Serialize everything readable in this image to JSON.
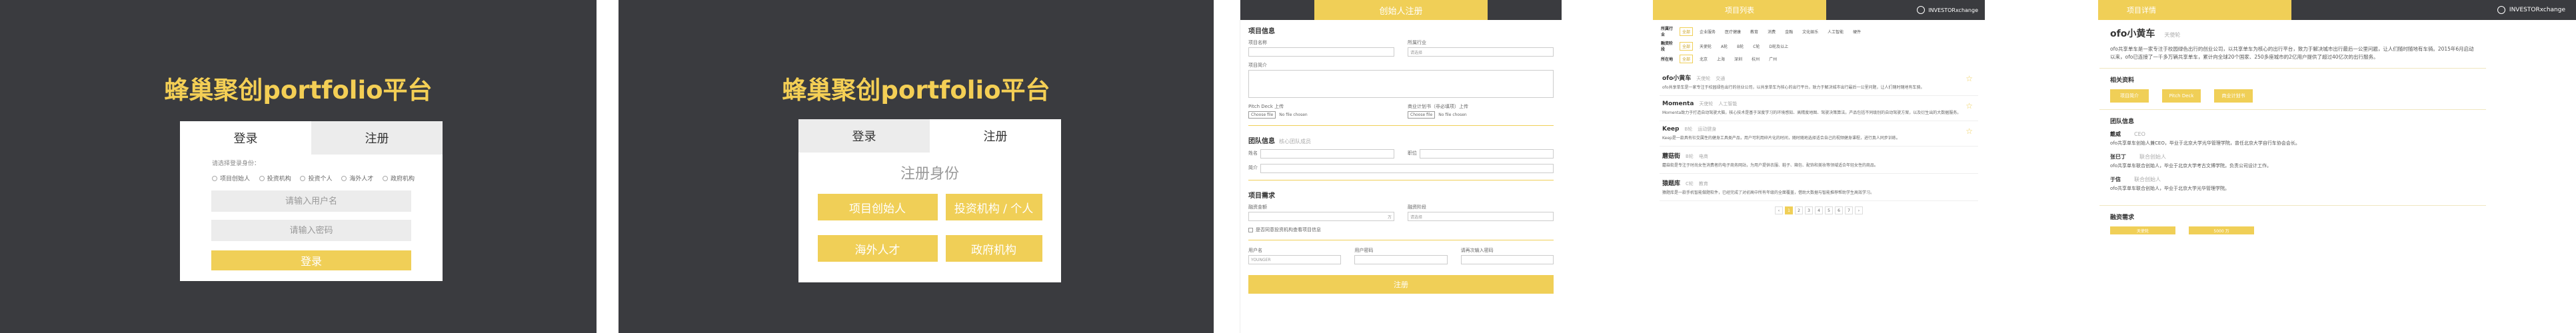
{
  "app_title": "蜂巢聚创portfolio平台",
  "login": {
    "tab_login": "登录",
    "tab_register": "注册",
    "role_prompt": "请选择登录身份：",
    "roles": [
      "项目创始人",
      "投资机构",
      "投资个人",
      "海外人才",
      "政府机构"
    ],
    "username_placeholder": "请输入用户名",
    "password_placeholder": "请输入密码",
    "submit": "登录"
  },
  "register": {
    "tab_login": "登录",
    "tab_register": "注册",
    "identity_label": "注册身份",
    "identities": [
      "项目创始人",
      "投资机构 / 个人",
      "海外人才",
      "政府机构"
    ]
  },
  "founder_form": {
    "title": "创始人注册",
    "sec_project": "项目信息",
    "project_name": "项目名称",
    "industry": "所属行业",
    "industry_value": "请选择",
    "intro": "项目简介",
    "pitch_deck": "Pitch Deck 上传",
    "bp": "商业计划书（非必填项）上传",
    "choose_file": "Choose file",
    "no_file": "No file chosen",
    "sec_team": "团队信息",
    "sec_team_sub": "核心团队成员",
    "name": "姓名",
    "title_field": "职位",
    "bio": "简介",
    "sec_fund": "项目需求",
    "fund_amount": "融资金额",
    "fund_stage": "融资阶段",
    "unit": "万",
    "stage_value": "请选择",
    "agree": "是否同意投资机构查看项目信息",
    "account": "用户名",
    "password": "用户密码",
    "password2": "请再次输入密码",
    "account_placeholder": "YOUNGER",
    "submit": "注册"
  },
  "project_list": {
    "title": "项目列表",
    "brand": "INVESTORxchange",
    "filters": [
      {
        "label": "所属行业",
        "chips": [
          "全部",
          "企业服务",
          "医疗健康",
          "教育",
          "消费",
          "金融",
          "文化娱乐",
          "人工智能",
          "硬件"
        ]
      },
      {
        "label": "融资阶段",
        "chips": [
          "全部",
          "天使轮",
          "A轮",
          "B轮",
          "C轮",
          "D轮及以上"
        ]
      },
      {
        "label": "所在地",
        "chips": [
          "全部",
          "北京",
          "上海",
          "深圳",
          "杭州",
          "广州"
        ]
      }
    ],
    "projects": [
      {
        "name": "ofo小黄车",
        "stage": "天使轮",
        "tag": "交通",
        "desc": "ofo共享单车是一家专注于校园绿色出行的创业公司，以共享单车为核心的出行平台，致力于解决城市出行最后一公里问题，让人们随时随地有车骑。"
      },
      {
        "name": "Momenta",
        "stage": "天使轮",
        "tag": "人工智能",
        "desc": "Momenta致力于打造自动驾驶大脑，核心技术是基于深度学习的环境感知、高精度地图、驾驶决策算法。产品包括不同级别的自动驾驶方案，以及衍生出的大数据服务。"
      },
      {
        "name": "Keep",
        "stage": "B轮",
        "tag": "运动健身",
        "desc": "Keep是一款具有社交属性的健身工具类产品，用户可利用碎片化的时间，随时随地选择适合自己的视频健身课程，进行真人同步训练。"
      },
      {
        "name": "蘑菇街",
        "stage": "B轮",
        "tag": "电商",
        "desc": "蘑菇街是专注于时尚女性消费者的电子商务网站，为用户提供衣服、鞋子、箱包、配饰和美妆等领域适合年轻女性的商品。"
      },
      {
        "name": "猿题库",
        "stage": "C轮",
        "tag": "教育",
        "desc": "猿题库是一款手机智能做题软件，已经完成了对初高中所有年级的全面覆盖，借助大数据与智能推荐帮助学生高效学习。"
      }
    ],
    "pages": [
      "‹",
      "1",
      "2",
      "3",
      "4",
      "5",
      "6",
      "7",
      "›"
    ]
  },
  "project_detail": {
    "title": "项目详情",
    "brand": "INVESTORxchange",
    "name": "ofo小黄车",
    "stage": "天使轮",
    "desc": "ofo共享单车是一家专注于校园绿色出行的创业公司，以共享单车为核心的出行平台，致力于解决城市出行最后一公里问题，让人们随时随地有车骑。2015年6月启动以来，ofo已连接了一千多万辆共享单车，累计向全球20个国家、250多座城市的2亿用户提供了超过40亿次的出行服务。",
    "materials_title": "相关资料",
    "materials": [
      "项目简介",
      "Pitch Deck",
      "商业计划书"
    ],
    "team_title": "团队信息",
    "members": [
      {
        "name": "戴威",
        "role": "CEO",
        "desc": "ofo共享单车创始人兼CEO，毕业于北京大学光华管理学院，曾任北京大学自行车协会会长。"
      },
      {
        "name": "张巳丁",
        "role": "联合创始人",
        "desc": "ofo共享单车联合创始人，毕业于北京大学考古文博学院，负责公司设计工作。"
      },
      {
        "name": "于信",
        "role": "联合创始人",
        "desc": "ofo共享单车联合创始人，毕业于北京大学光华管理学院。"
      }
    ],
    "fund_title": "融资需求",
    "fund_stage": "天使轮",
    "fund_amount": "5000 万"
  }
}
